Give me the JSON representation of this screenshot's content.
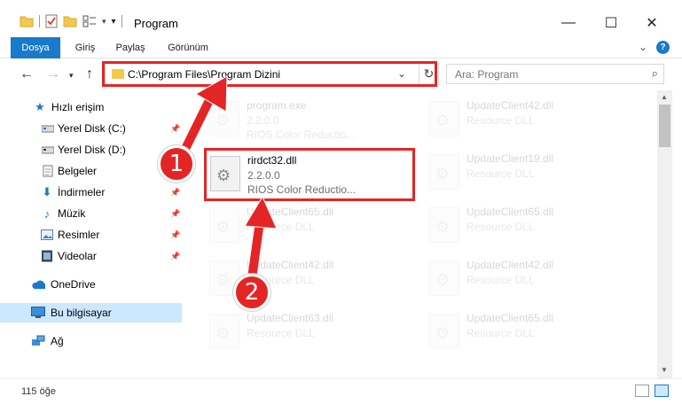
{
  "window": {
    "title": "Program",
    "minimize": "—",
    "maximize": "☐",
    "close": "✕"
  },
  "ribbon": {
    "tabs": [
      "Dosya",
      "Giriş",
      "Paylaş",
      "Görünüm"
    ],
    "expand_glyph": "⌄"
  },
  "address": {
    "path": "C:\\Program Files\\Program Dizini",
    "search_placeholder": "Ara: Program"
  },
  "nav": {
    "quick_access": "Hızlı erişim",
    "items": [
      {
        "label": "Yerel Disk (C:)",
        "icon": "drive-icon",
        "pinned": true
      },
      {
        "label": "Yerel Disk (D:)",
        "icon": "drive-icon",
        "pinned": false
      },
      {
        "label": "Belgeler",
        "icon": "documents-icon",
        "pinned": true
      },
      {
        "label": "İndirmeler",
        "icon": "download-icon",
        "pinned": true
      },
      {
        "label": "Müzik",
        "icon": "music-icon",
        "pinned": true
      },
      {
        "label": "Resimler",
        "icon": "pictures-icon",
        "pinned": true
      },
      {
        "label": "Videolar",
        "icon": "videos-icon",
        "pinned": true
      }
    ],
    "onedrive": "OneDrive",
    "this_pc": "Bu bilgisayar",
    "network": "Ağ"
  },
  "files": {
    "highlighted": {
      "name": "rirdct32.dll",
      "version": "2.2.0.0",
      "description": "RIOS Color Reductio..."
    },
    "behind": {
      "name": "program.exe",
      "version": "2.2.0.0",
      "description": "RIOS Color Reductio..."
    },
    "left_column": [
      {
        "name": "UpdateClient65.dll",
        "type": "Resource DLL"
      },
      {
        "name": "UpdateClient42.dll",
        "type": "Resource DLL"
      },
      {
        "name": "UpdateClient63.dll",
        "type": "Resource DLL"
      }
    ],
    "right_column": [
      {
        "name": "UpdateClient42.dll",
        "type": "Resource DLL"
      },
      {
        "name": "UpdateClient19.dll",
        "type": "Resource DLL"
      },
      {
        "name": "UpdateClient65.dll",
        "type": "Resource DLL"
      },
      {
        "name": "UpdateClient42.dll",
        "type": "Resource DLL"
      },
      {
        "name": "UpdateClient65.dll",
        "type": "Resource DLL"
      }
    ]
  },
  "annotations": {
    "step1": "1",
    "step2": "2",
    "color": "#e42525"
  },
  "status": {
    "item_count": "115 öğe"
  },
  "colors": {
    "accent": "#1979ca",
    "selection": "#cce8ff",
    "highlight_red": "#e42525"
  }
}
